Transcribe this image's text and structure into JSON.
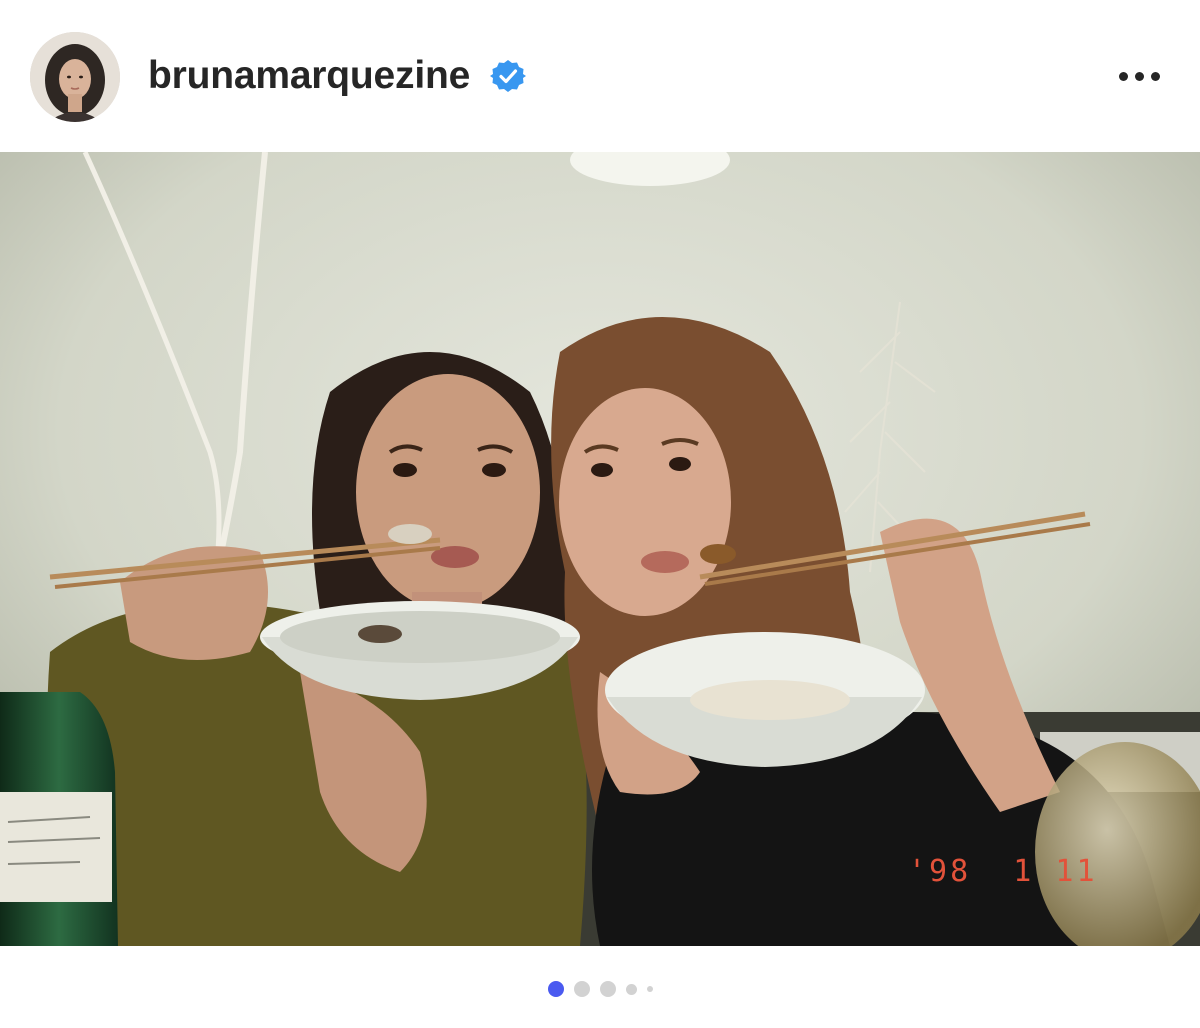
{
  "post": {
    "username": "brunamarquezine",
    "verified": true,
    "photo_date_stamp": "'98  1 11"
  },
  "carousel": {
    "total": 5,
    "active_index": 0
  },
  "colors": {
    "verified_blue": "#3897f0",
    "active_dot": "#4a5af0",
    "inactive_dot": "#d2d2d2",
    "date_stamp": "#e2523a"
  },
  "icons": {
    "verified": "verified-badge-icon",
    "more": "more-options-icon"
  }
}
